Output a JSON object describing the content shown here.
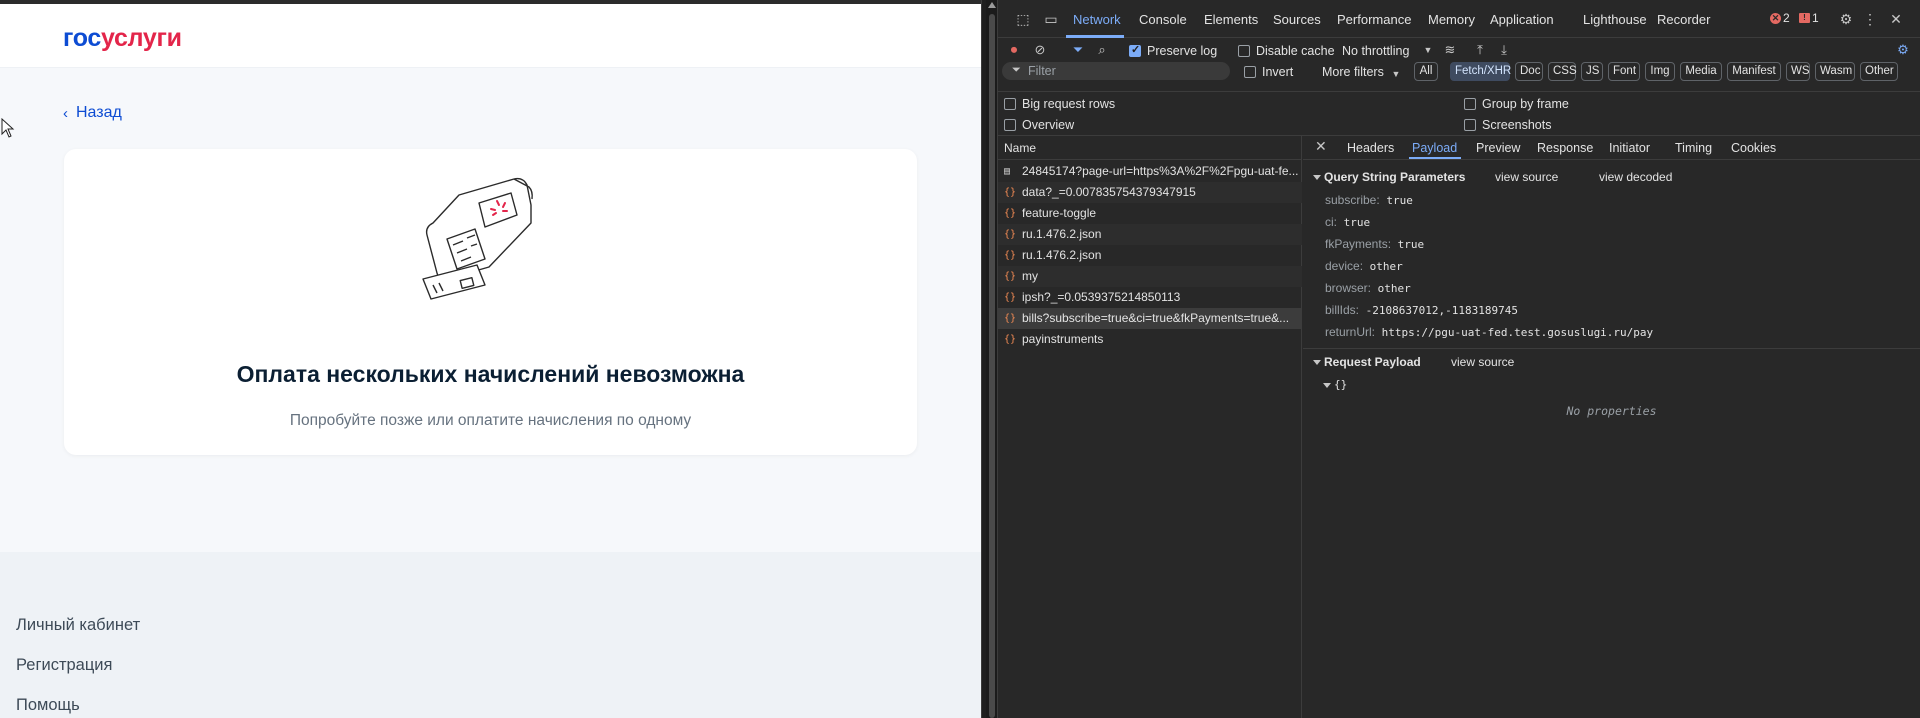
{
  "site": {
    "logo_part1": "гос",
    "logo_part2": "услуги",
    "back_label": "Назад",
    "title": "Оплата нескольких начислений невозможна",
    "subtitle": "Попробуйте позже или оплатите начисления по одному",
    "footer_links": [
      "Личный кабинет",
      "Регистрация",
      "Помощь"
    ],
    "colors": {
      "brand_blue": "#0d4cd3",
      "brand_red": "#e3254a"
    }
  },
  "devtools": {
    "tabs": [
      "Network",
      "Console",
      "Elements",
      "Sources",
      "Performance",
      "Memory",
      "Application",
      "Lighthouse",
      "Recorder"
    ],
    "active_tab": "Network",
    "errors_count": "2",
    "issues_count": "1",
    "toolbar": {
      "preserve_log": "Preserve log",
      "disable_cache": "Disable cache",
      "throttling": "No throttling",
      "filter_placeholder": "Filter",
      "invert": "Invert",
      "more_filters": "More filters",
      "types": [
        "All",
        "Fetch/XHR",
        "Doc",
        "CSS",
        "JS",
        "Font",
        "Img",
        "Media",
        "Manifest",
        "WS",
        "Wasm",
        "Other"
      ],
      "active_type": "Fetch/XHR"
    },
    "options": {
      "big_request_rows": "Big request rows",
      "group_by_frame": "Group by frame",
      "overview": "Overview",
      "screenshots": "Screenshots"
    },
    "requests": {
      "header": "Name",
      "items": [
        {
          "name": "24845174?page-url=https%3A%2F%2Fpgu-uat-fe...",
          "type": "doc"
        },
        {
          "name": "data?_=0.007835754379347915",
          "type": "xhr"
        },
        {
          "name": "feature-toggle",
          "type": "xhr"
        },
        {
          "name": "ru.1.476.2.json",
          "type": "xhr"
        },
        {
          "name": "ru.1.476.2.json",
          "type": "xhr"
        },
        {
          "name": "my",
          "type": "xhr"
        },
        {
          "name": "ipsh?_=0.0539375214850113",
          "type": "xhr"
        },
        {
          "name": "bills?subscribe=true&ci=true&fkPayments=true&...",
          "type": "xhr",
          "selected": true
        },
        {
          "name": "payinstruments",
          "type": "xhr"
        }
      ]
    },
    "detail": {
      "tabs": [
        "Headers",
        "Payload",
        "Preview",
        "Response",
        "Initiator",
        "Timing",
        "Cookies"
      ],
      "active_tab": "Payload",
      "query_section": "Query String Parameters",
      "view_source": "view source",
      "view_decoded": "view decoded",
      "params": [
        {
          "key": "subscribe:",
          "value": "true"
        },
        {
          "key": "ci:",
          "value": "true"
        },
        {
          "key": "fkPayments:",
          "value": "true"
        },
        {
          "key": "device:",
          "value": "other"
        },
        {
          "key": "browser:",
          "value": "other"
        },
        {
          "key": "billIds:",
          "value": "-2108637012,-1183189745"
        },
        {
          "key": "returnUrl:",
          "value": "https://pgu-uat-fed.test.gosuslugi.ru/pay"
        }
      ],
      "payload_section": "Request Payload",
      "payload_view_source": "view source",
      "payload_object": "{}",
      "no_properties": "No properties"
    }
  }
}
